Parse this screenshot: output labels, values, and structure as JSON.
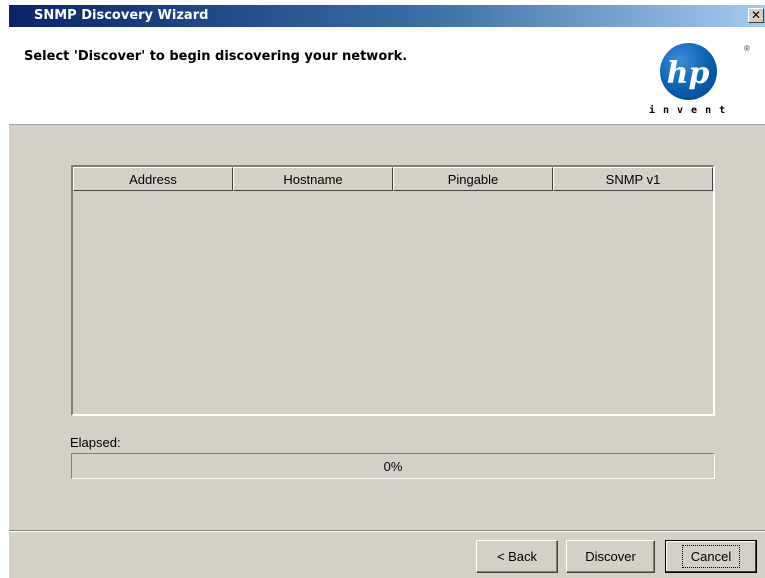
{
  "window": {
    "title": "SNMP Discovery Wizard",
    "close_glyph": "✕"
  },
  "header": {
    "instruction": "Select 'Discover' to begin discovering your network.",
    "logo": {
      "brand": "hp",
      "tagline": "invent",
      "registered": "®"
    }
  },
  "table": {
    "columns": [
      "Address",
      "Hostname",
      "Pingable",
      "SNMP v1"
    ],
    "rows": []
  },
  "progress": {
    "label": "Elapsed:",
    "percent_text": "0%",
    "value": 0
  },
  "buttons": {
    "back": "< Back",
    "discover": "Discover",
    "cancel": "Cancel"
  },
  "colors": {
    "title_bar_start": "#0a246a",
    "title_bar_end": "#a6caf0",
    "dialog_face": "#d4d0c8",
    "hp_blue": "#0a5cb0"
  }
}
